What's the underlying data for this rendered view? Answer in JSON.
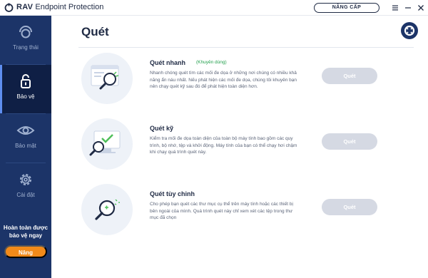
{
  "window": {
    "app_name_bold": "RAV",
    "app_name_rest": " Endpoint Protection",
    "upgrade_label": "NÂNG CẤP"
  },
  "sidebar": {
    "items": [
      {
        "label": "Trạng thái",
        "icon": "status-icon",
        "active": false
      },
      {
        "label": "Bảo vệ",
        "icon": "lock-icon",
        "active": true
      },
      {
        "label": "Bảo mật",
        "icon": "eye-icon",
        "active": false
      },
      {
        "label": "Cài đặt",
        "icon": "gear-icon",
        "active": false
      }
    ],
    "promo": {
      "text": "Hoàn toàn được bảo vệ ngay",
      "button_label": "Nâng"
    }
  },
  "main": {
    "title": "Quét",
    "support_icon": "support-icon",
    "scans": [
      {
        "name": "Quét nhanh",
        "badge": "(Khuyên dùng)",
        "description": "Nhanh chóng quét tìm các mối đe dọa ở những nơi chúng có nhiều khả năng ẩn náu nhất. Nếu phát hiện các mối đe dọa, chúng tôi khuyên bạn nên chạy quét kỹ sau đó để phát hiện toàn diện hơn.",
        "button_label": "Quét",
        "icon": "quick-scan-illustration"
      },
      {
        "name": "Quét kỹ",
        "badge": "",
        "description": "Kiểm tra mối đe dọa toàn diện của toàn bộ máy tính bao gồm các quy trình, bộ nhớ, tệp và khởi động. Máy tính của bạn có thể chạy hơi chậm khi chạy quá trình quét này.",
        "button_label": "Quét",
        "icon": "full-scan-illustration"
      },
      {
        "name": "Quét tùy chỉnh",
        "badge": "",
        "description": "Cho phép bạn quét các thư mục cụ thể trên máy tính hoặc các thiết bị bên ngoài của mình. Quá trình quét này chỉ xem xét các tệp trong thư mục đã chọn",
        "button_label": "Quét",
        "icon": "custom-scan-illustration"
      }
    ]
  },
  "colors": {
    "sidebar_bg": "#1c3468",
    "sidebar_active_bg": "#0f1f45",
    "accent_orange": "#f28a1a",
    "badge_green": "#1f9e4a",
    "scan_button_disabled": "#d5d9e3"
  }
}
